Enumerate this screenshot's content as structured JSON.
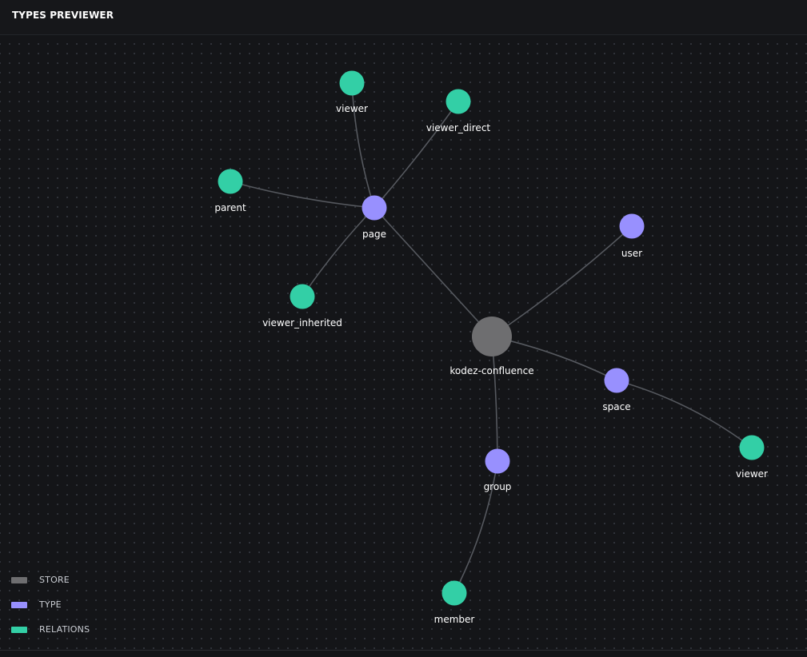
{
  "header": {
    "title": "TYPES PREVIEWER"
  },
  "colors": {
    "store": "#6e6e70",
    "type": "#9890fe",
    "relation": "#33cfa6",
    "edge": "#55585e"
  },
  "graph": {
    "nodes": [
      {
        "id": "store",
        "label": "kodez-confluence",
        "kind": "store"
      },
      {
        "id": "page",
        "label": "page",
        "kind": "type"
      },
      {
        "id": "user",
        "label": "user",
        "kind": "type"
      },
      {
        "id": "space",
        "label": "space",
        "kind": "type"
      },
      {
        "id": "group",
        "label": "group",
        "kind": "type"
      },
      {
        "id": "page-viewer",
        "label": "viewer",
        "kind": "relation"
      },
      {
        "id": "page-viewer-direct",
        "label": "viewer_direct",
        "kind": "relation"
      },
      {
        "id": "page-parent",
        "label": "parent",
        "kind": "relation"
      },
      {
        "id": "page-viewer-inherited",
        "label": "viewer_inherited",
        "kind": "relation"
      },
      {
        "id": "space-viewer",
        "label": "viewer",
        "kind": "relation"
      },
      {
        "id": "group-member",
        "label": "member",
        "kind": "relation"
      }
    ],
    "edges": [
      [
        "store",
        "page"
      ],
      [
        "store",
        "user"
      ],
      [
        "store",
        "space"
      ],
      [
        "store",
        "group"
      ],
      [
        "page",
        "page-viewer"
      ],
      [
        "page",
        "page-viewer-direct"
      ],
      [
        "page",
        "page-parent"
      ],
      [
        "page",
        "page-viewer-inherited"
      ],
      [
        "space",
        "space-viewer"
      ],
      [
        "group",
        "group-member"
      ]
    ]
  },
  "legend": [
    {
      "label": "STORE",
      "kind": "store"
    },
    {
      "label": "TYPE",
      "kind": "type"
    },
    {
      "label": "RELATIONS",
      "kind": "relation"
    }
  ]
}
